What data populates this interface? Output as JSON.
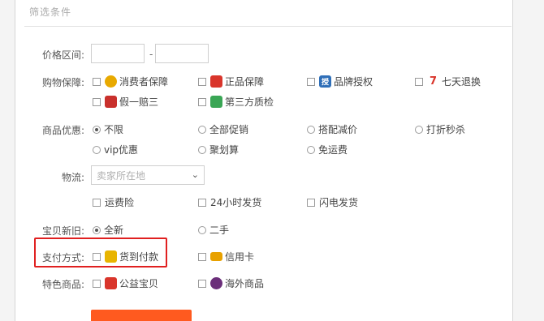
{
  "heading": "筛选条件",
  "price": {
    "label": "价格区间:",
    "separator": "-"
  },
  "shopping_guarantee": {
    "label": "购物保障:",
    "options": [
      {
        "text": "消费者保障",
        "icon": "consumer-shield-icon",
        "color": "#e8a900"
      },
      {
        "text": "正品保障",
        "icon": "authentic-icon",
        "color": "#d9352b"
      },
      {
        "text": "品牌授权",
        "icon": "brand-auth-icon",
        "color": "#2f6fb8",
        "glyph": "授"
      },
      {
        "text": "七天退换",
        "icon": "seven-day-return-icon",
        "color": "#d9352b",
        "glyph": "7"
      },
      {
        "text": "假一赔三",
        "icon": "fake-compensation-icon",
        "color": "#c9302c"
      },
      {
        "text": "第三方质检",
        "icon": "quality-check-icon",
        "color": "#3aa655"
      }
    ]
  },
  "discount": {
    "label": "商品优惠:",
    "options": [
      "不限",
      "全部促销",
      "搭配减价",
      "打折秒杀",
      "vip优惠",
      "聚划算",
      "免运费"
    ],
    "selected": "不限"
  },
  "logistics": {
    "label": "物流:",
    "placeholder": "卖家所在地",
    "options": [
      "运费险",
      "24小时发货",
      "闪电发货"
    ]
  },
  "condition": {
    "label": "宝贝新旧:",
    "options": [
      "全新",
      "二手"
    ],
    "selected": "全新"
  },
  "payment": {
    "label": "支付方式:",
    "options": [
      {
        "text": "货到付款",
        "icon": "cash-on-delivery-icon",
        "color": "#e8b400"
      },
      {
        "text": "信用卡",
        "icon": "credit-card-icon",
        "color": "#e8a100"
      }
    ]
  },
  "special": {
    "label": "特色商品:",
    "options": [
      {
        "text": "公益宝贝",
        "icon": "charity-icon",
        "color": "#d9352b"
      },
      {
        "text": "海外商品",
        "icon": "overseas-icon",
        "color": "#6b2e7a"
      }
    ]
  },
  "colors": {
    "highlight": "#e02020",
    "accent_button": "#ff5a1f"
  }
}
